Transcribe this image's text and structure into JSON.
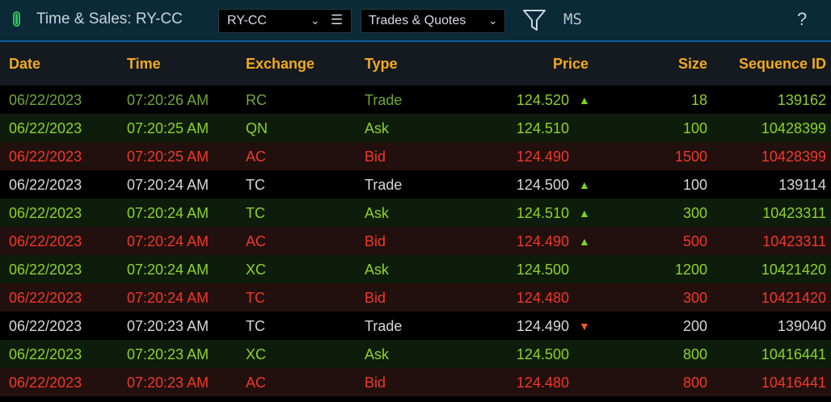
{
  "window": {
    "title": "Time & Sales: RY-CC",
    "symbol": "RY-CC",
    "mode": "Trades & Quotes",
    "ms_label": "MS",
    "help": "?"
  },
  "colors": {
    "header_text": "#f2a91f",
    "trade_text": "#d8d8d8",
    "ask_text": "#8dd22c",
    "bid_text": "#f0382a",
    "first_trade_text": "#6fa83b",
    "trade_bg": "#000000",
    "ask_bg": "#0e1d0b",
    "bid_bg": "#21100e",
    "up_arrow": "#7ed321",
    "down_arrow": "#f05a28"
  },
  "columns": {
    "date": "Date",
    "time": "Time",
    "exchange": "Exchange",
    "type": "Type",
    "price": "Price",
    "size": "Size",
    "sequence": "Sequence ID"
  },
  "rows": [
    {
      "date": "06/22/2023",
      "time": "07:20:26 AM",
      "exchange": "RC",
      "type": "Trade",
      "price": "124.520",
      "arrow": "▲",
      "arrow_dir": "up",
      "size": "18",
      "sequence": "139162",
      "style": "first"
    },
    {
      "date": "06/22/2023",
      "time": "07:20:25 AM",
      "exchange": "QN",
      "type": "Ask",
      "price": "124.510",
      "arrow": "",
      "arrow_dir": "",
      "size": "100",
      "sequence": "10428399",
      "style": "ask"
    },
    {
      "date": "06/22/2023",
      "time": "07:20:25 AM",
      "exchange": "AC",
      "type": "Bid",
      "price": "124.490",
      "arrow": "",
      "arrow_dir": "",
      "size": "1500",
      "sequence": "10428399",
      "style": "bid"
    },
    {
      "date": "06/22/2023",
      "time": "07:20:24 AM",
      "exchange": "TC",
      "type": "Trade",
      "price": "124.500",
      "arrow": "▲",
      "arrow_dir": "up",
      "size": "100",
      "sequence": "139114",
      "style": "trade"
    },
    {
      "date": "06/22/2023",
      "time": "07:20:24 AM",
      "exchange": "TC",
      "type": "Ask",
      "price": "124.510",
      "arrow": "▲",
      "arrow_dir": "up",
      "size": "300",
      "sequence": "10423311",
      "style": "ask"
    },
    {
      "date": "06/22/2023",
      "time": "07:20:24 AM",
      "exchange": "AC",
      "type": "Bid",
      "price": "124.490",
      "arrow": "▲",
      "arrow_dir": "up",
      "size": "500",
      "sequence": "10423311",
      "style": "bid"
    },
    {
      "date": "06/22/2023",
      "time": "07:20:24 AM",
      "exchange": "XC",
      "type": "Ask",
      "price": "124.500",
      "arrow": "",
      "arrow_dir": "",
      "size": "1200",
      "sequence": "10421420",
      "style": "ask"
    },
    {
      "date": "06/22/2023",
      "time": "07:20:24 AM",
      "exchange": "TC",
      "type": "Bid",
      "price": "124.480",
      "arrow": "",
      "arrow_dir": "",
      "size": "300",
      "sequence": "10421420",
      "style": "bid"
    },
    {
      "date": "06/22/2023",
      "time": "07:20:23 AM",
      "exchange": "TC",
      "type": "Trade",
      "price": "124.490",
      "arrow": "▼",
      "arrow_dir": "down",
      "size": "200",
      "sequence": "139040",
      "style": "trade"
    },
    {
      "date": "06/22/2023",
      "time": "07:20:23 AM",
      "exchange": "XC",
      "type": "Ask",
      "price": "124.500",
      "arrow": "",
      "arrow_dir": "",
      "size": "800",
      "sequence": "10416441",
      "style": "ask"
    },
    {
      "date": "06/22/2023",
      "time": "07:20:23 AM",
      "exchange": "AC",
      "type": "Bid",
      "price": "124.480",
      "arrow": "",
      "arrow_dir": "",
      "size": "800",
      "sequence": "10416441",
      "style": "bid"
    }
  ]
}
